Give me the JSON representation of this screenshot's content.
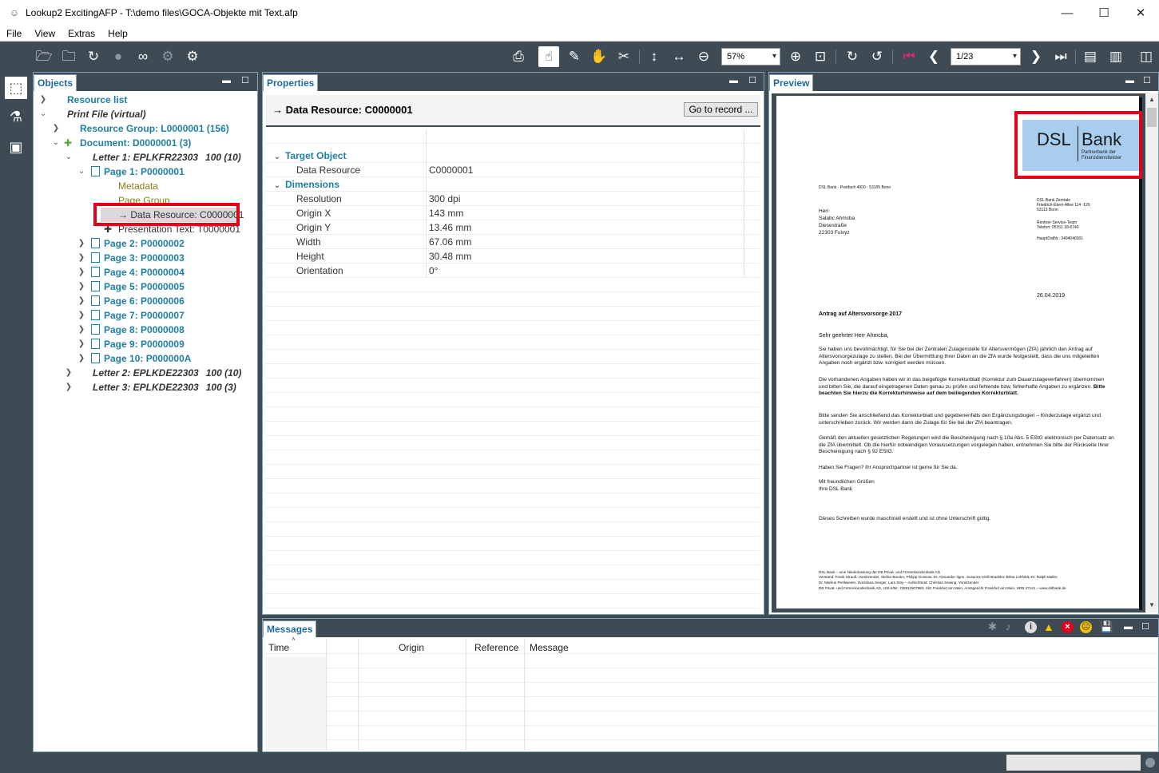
{
  "window": {
    "title": "Lookup2 ExcitingAFP - T:\\demo files\\GOCA-Objekte mit Text.afp"
  },
  "menu": [
    "File",
    "View",
    "Extras",
    "Help"
  ],
  "toolbar": {
    "zoom": "57%",
    "page": "1/23"
  },
  "objects_panel": {
    "title": "Objects",
    "tree": [
      {
        "label": "Resource list"
      },
      {
        "label": "Print File (virtual)"
      },
      {
        "label": "Resource Group: L0000001 (156)"
      },
      {
        "label": "Document: D0000001 (3)"
      },
      {
        "label": "Letter 1: EPLKFR22303",
        "count": "100 (10)"
      },
      {
        "label": "Page 1: P0000001"
      },
      {
        "label": "Metadata"
      },
      {
        "label": "Page Group"
      },
      {
        "label": "→ Data Resource: C0000001"
      },
      {
        "label": "Presentation Text: T0000001"
      },
      {
        "label": "Page 2: P0000002"
      },
      {
        "label": "Page 3: P0000003"
      },
      {
        "label": "Page 4: P0000004"
      },
      {
        "label": "Page 5: P0000005"
      },
      {
        "label": "Page 6: P0000006"
      },
      {
        "label": "Page 7: P0000007"
      },
      {
        "label": "Page 8: P0000008"
      },
      {
        "label": "Page 9: P0000009"
      },
      {
        "label": "Page 10: P000000A"
      },
      {
        "label": "Letter 2: EPLKDE22303",
        "count": "100 (10)"
      },
      {
        "label": "Letter 3: EPLKDE22303",
        "count": "100 (3)"
      }
    ]
  },
  "properties_panel": {
    "title": "Properties",
    "heading": "→ Data Resource: C0000001",
    "goto_button": "Go to record ...",
    "groups": [
      {
        "name": "Target Object",
        "rows": [
          {
            "key": "Data Resource",
            "value": "C0000001"
          }
        ]
      },
      {
        "name": "Dimensions",
        "rows": [
          {
            "key": "Resolution",
            "value": "300 dpi"
          },
          {
            "key": "Origin X",
            "value": "143 mm"
          },
          {
            "key": "Origin Y",
            "value": "13.46 mm"
          },
          {
            "key": "Width",
            "value": "67.06 mm"
          },
          {
            "key": "Height",
            "value": "30.48 mm"
          },
          {
            "key": "Orientation",
            "value": "0°"
          }
        ]
      }
    ]
  },
  "preview_panel": {
    "title": "Preview",
    "doc": {
      "logo_dsl": "DSL",
      "logo_bank": "Bank",
      "logo_sub1": "Partnerbank der",
      "logo_sub2": "Finanzdienstleister",
      "sender_line": "DSL Bank · Postfach 4000 · 53105 Bonn",
      "recipient": [
        "Herr",
        "Salabc Ahmcba",
        "Diesestraße",
        "22303 Fulxyz"
      ],
      "bank_addr": [
        "DSL Bank Zentrale",
        "Friedrich-Ebert-Allee 114 -126",
        "53113 Bonn"
      ],
      "service": [
        "Rentner-Service-Team",
        "Telefon: 05151 18-6740"
      ],
      "hauptdatei": "HauptDatNr.: 3494046001",
      "date": "26.04.2019",
      "subject": "Antrag auf Altersvorsorge 2017",
      "salutation": "Sehr geehrter Herr Ahmcba,",
      "p1": "Sie haben uns bevollmächtigt, für Sie bei der Zentralen Zulagenstelle für Altersvermögen (ZfA) jährlich den Antrag auf Altersvorsorgezulage zu stellen. Bei der Übermittlung Ihrer Daten an die ZfA wurde festgestellt, dass die uns mitgeteilten Angaben noch ergänzt bzw. korrigiert werden müssen.",
      "p2": "Die vorhandenen Angaben haben wir in das beigefügte Korrekturblatt (Korrektur zum Dauerzulageverfahren) übernommen und bitten Sie, die darauf eingetragenen Daten genau zu prüfen und fehlende bzw. fehlerhafte Angaben zu ergänzen.",
      "p2_bold": "Bitte beachten Sie hierzu die Korrekturhinweise auf dem beiliegenden Korrekturblatt.",
      "p3": "Bitte senden Sie anschließend das Korrekturblatt und gegebenenfalls den Ergänzungsbogen – Kinderzulage ergänzt und unterschrieben zurück. Wir werden dann die Zulage für Sie bei der ZfA beantragen.",
      "p4": "Gemäß den aktuellen gesetzlichen Regelungen wird die Bescheinigung nach § 10a Abs. 5 EStG elektronisch per Datensatz an die ZfA übermittelt. Ob die hierfür notwendigen Voraussetzungen vorgelegen haben, entnehmen Sie bitte der Rückseite Ihrer Bescheinigung nach § 92 EStG.",
      "p5": "Haben Sie Fragen? Ihr Ansprechpartner ist gerne für Sie da.",
      "closing": [
        "Mit freundlichen Grüßen",
        "Ihre DSL Bank"
      ],
      "machine": "Dieses Schreiben wurde maschinell erstellt und ist ohne Unterschrift gültig.",
      "footer": [
        "DSL Bank – eine Niederlassung der DB Privat- und Firmenkundenbank AG",
        "Vorstand: Frank Strauß, Vorsitzender, Stefan Bender, Philipp Gossow, Dr. Alexander Ilgen, Susanne Klöß-Braekler, Britta Lehfeldt, Dr. Ralph Müller,",
        "Dr. Markus Pertlwieser, Zvezdana Seeger, Lars Stoy – Aufsichtsrat: Christian Sewing, Vorsitzender",
        "DB Privat- und Firmenkundenbank AG, USt-IdNr.: DE811907980, Sitz Frankfurt am Main, Amtsgericht Frankfurt am Main, HRB 47141 – www.dslbank.de"
      ]
    }
  },
  "messages_panel": {
    "title": "Messages",
    "columns": [
      "Time",
      "",
      "Origin",
      "Reference",
      "Message"
    ]
  },
  "colors": {
    "chrome": "#3e4b55",
    "accent": "#1e7fa3",
    "highlight": "#e3001b",
    "logo_bg": "#a8cdee"
  }
}
